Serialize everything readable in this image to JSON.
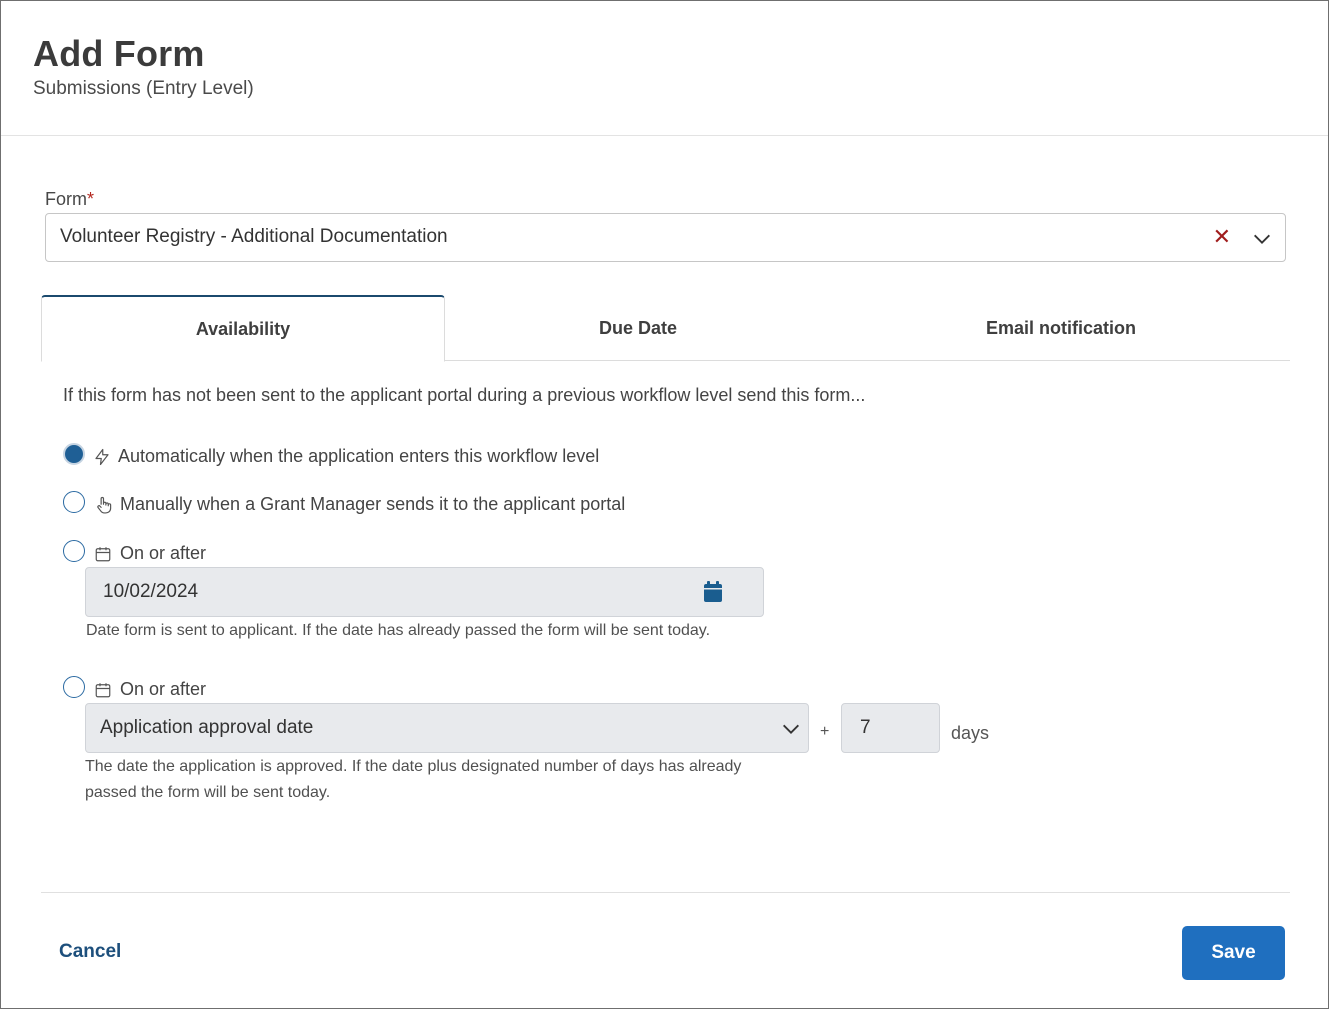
{
  "header": {
    "title": "Add Form",
    "subtitle": "Submissions (Entry Level)"
  },
  "form_field": {
    "label": "Form",
    "required_mark": "*",
    "value": "Volunteer Registry - Additional Documentation",
    "clear_icon": "close-icon",
    "dropdown_icon": "chevron-down-icon"
  },
  "tabs": [
    {
      "label": "Availability",
      "active": true
    },
    {
      "label": "Due Date",
      "active": false
    },
    {
      "label": "Email notification",
      "active": false
    }
  ],
  "availability": {
    "intro": "If this form has not been sent to the applicant portal during a previous workflow level send this form...",
    "options": [
      {
        "label": "Automatically when the application enters this workflow level",
        "icon": "lightning-icon",
        "selected": true
      },
      {
        "label": "Manually when a Grant Manager sends it to the applicant portal",
        "icon": "hand-pointer-icon",
        "selected": false
      },
      {
        "label": "On or after",
        "icon": "calendar-icon",
        "selected": false
      },
      {
        "label": "On or after",
        "icon": "calendar-icon",
        "selected": false
      }
    ],
    "date_value": "10/02/2024",
    "date_help": "Date form is sent to applicant. If the date has already passed the form will be sent today.",
    "relative": {
      "selected": "Application approval date",
      "plus": "+",
      "days_value": "7",
      "days_label": "days",
      "help_line1": "The date the application is approved. If the date plus designated number of days has already",
      "help_line2": "passed the form will be sent today."
    }
  },
  "footer": {
    "cancel": "Cancel",
    "save": "Save"
  },
  "colors": {
    "accent": "#1f6fbf",
    "link": "#1d4f7c",
    "required": "#b3261e",
    "input_bg": "#e8eaed"
  }
}
